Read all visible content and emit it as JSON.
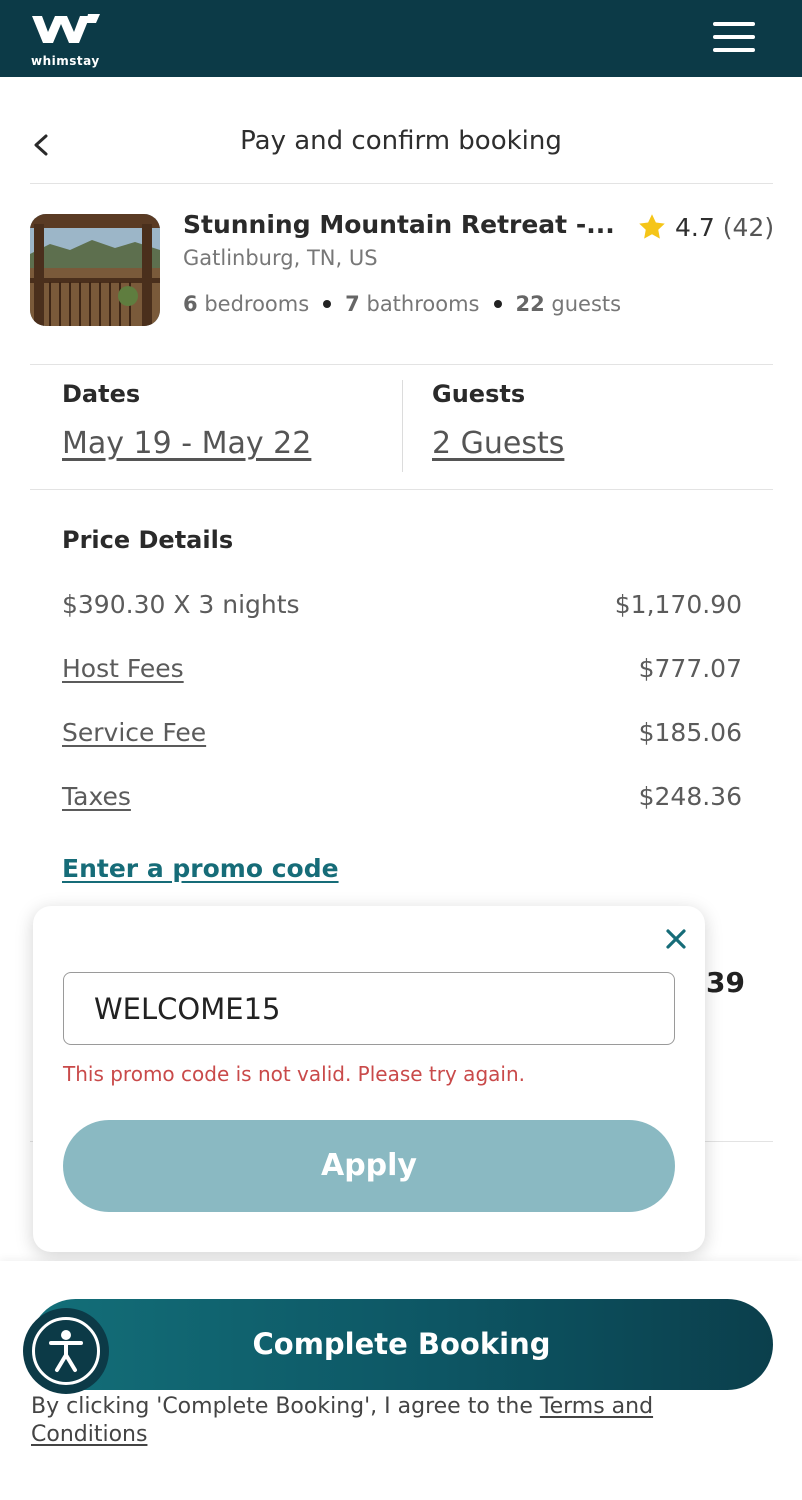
{
  "header": {
    "logo_text": "whimstay",
    "menu_icon": "hamburger-menu-icon"
  },
  "page": {
    "title": "Pay and confirm booking",
    "back_icon": "chevron-left-icon"
  },
  "property": {
    "name": "Stunning Mountain Retreat -...",
    "rating": "4.7",
    "review_count": "(42)",
    "location": "Gatlinburg, TN, US",
    "bedrooms_count": "6",
    "bedrooms_label": "bedrooms",
    "bathrooms_count": "7",
    "bathrooms_label": "bathrooms",
    "guests_count": "22",
    "guests_label": "guests",
    "star_color": "#f5c518"
  },
  "booking": {
    "dates_label": "Dates",
    "dates_value": "May 19 - May 22",
    "guests_label": "Guests",
    "guests_value": "2 Guests"
  },
  "price_details": {
    "heading": "Price Details",
    "rows": [
      {
        "label": "$390.30 X 3 nights",
        "amount": "$1,170.90"
      },
      {
        "label": "Host Fees",
        "amount": "$777.07"
      },
      {
        "label": "Service Fee",
        "amount": "$185.06"
      },
      {
        "label": "Taxes",
        "amount": "$248.36"
      }
    ],
    "promo_link": "Enter a promo code",
    "partial_total": "39"
  },
  "promo_popover": {
    "input_value": "WELCOME15",
    "error": "This promo code is not valid. Please try again.",
    "apply_label": "Apply",
    "error_color": "#c94a4a"
  },
  "footer": {
    "complete_label": "Complete Booking",
    "terms_prefix": "By clicking 'Complete Booking', I agree to the ",
    "terms_link": "Terms and Conditions",
    "accessibility_icon": "accessibility-icon"
  },
  "colors": {
    "brand_dark": "#0c3a47",
    "brand_teal": "#166c78",
    "apply_disabled": "#8ab9c2"
  }
}
